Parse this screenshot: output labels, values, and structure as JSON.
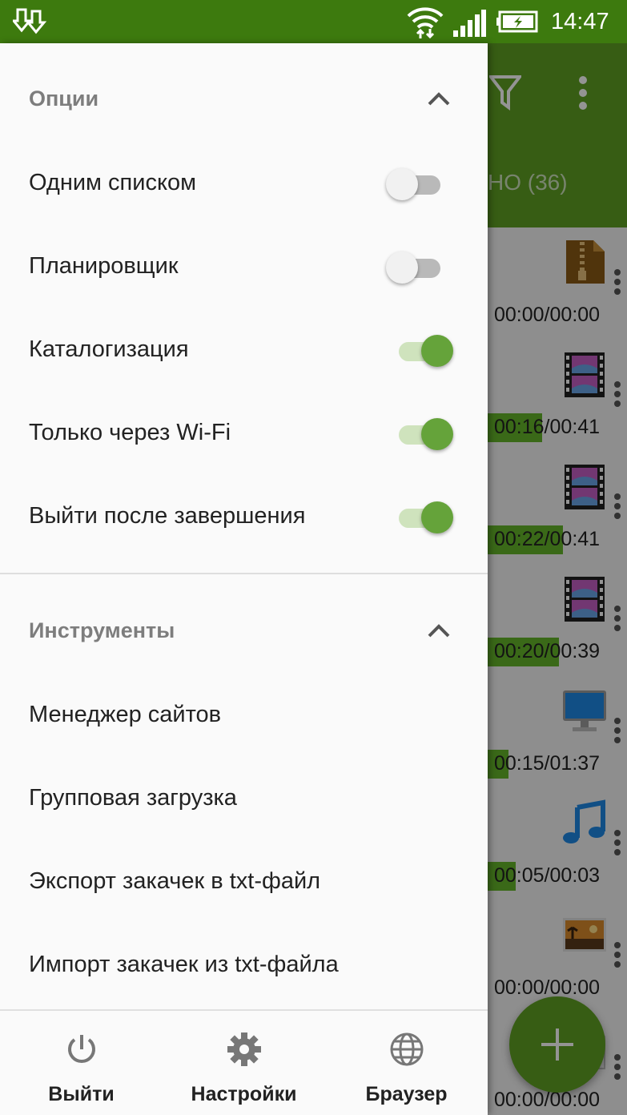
{
  "status_bar": {
    "time": "14:47"
  },
  "background_app": {
    "tab_label": "НО (36)",
    "rows": [
      {
        "icon": "archive-icon",
        "time": "00:00/00:00",
        "progress": 0
      },
      {
        "icon": "video-icon",
        "time": "00:16/00:41",
        "progress": 0.39
      },
      {
        "icon": "video-icon",
        "time": "00:22/00:41",
        "progress": 0.54
      },
      {
        "icon": "video-icon",
        "time": "00:20/00:39",
        "progress": 0.51
      },
      {
        "icon": "monitor-icon",
        "time": "00:15/01:37",
        "progress": 0.15
      },
      {
        "icon": "music-icon",
        "time": "00:05/00:03",
        "progress": 0.2
      },
      {
        "icon": "image-icon",
        "time": "00:00/00:00",
        "progress": 0
      },
      {
        "icon": "file-icon",
        "time": "00:00/00:00",
        "progress": 0
      }
    ]
  },
  "drawer": {
    "options": {
      "title": "Опции",
      "items": [
        {
          "label": "Одним списком",
          "on": false
        },
        {
          "label": "Планировщик",
          "on": false
        },
        {
          "label": "Каталогизация",
          "on": true
        },
        {
          "label": "Только через Wi-Fi",
          "on": true
        },
        {
          "label": "Выйти после завершения",
          "on": true
        }
      ]
    },
    "tools": {
      "title": "Инструменты",
      "items": [
        {
          "label": "Менеджер сайтов"
        },
        {
          "label": "Групповая загрузка"
        },
        {
          "label": "Экспорт закачек в txt-файл"
        },
        {
          "label": "Импорт закачек из txt-файла"
        }
      ]
    },
    "bottom_nav": [
      {
        "label": "Выйти",
        "icon": "power-icon"
      },
      {
        "label": "Настройки",
        "icon": "gear-icon"
      },
      {
        "label": "Браузер",
        "icon": "globe-icon"
      }
    ]
  },
  "colors": {
    "status_bar": "#3d7a0e",
    "toolbar": "#5fa023",
    "switch_on": "#65a33a",
    "progress": "#64b52a"
  }
}
